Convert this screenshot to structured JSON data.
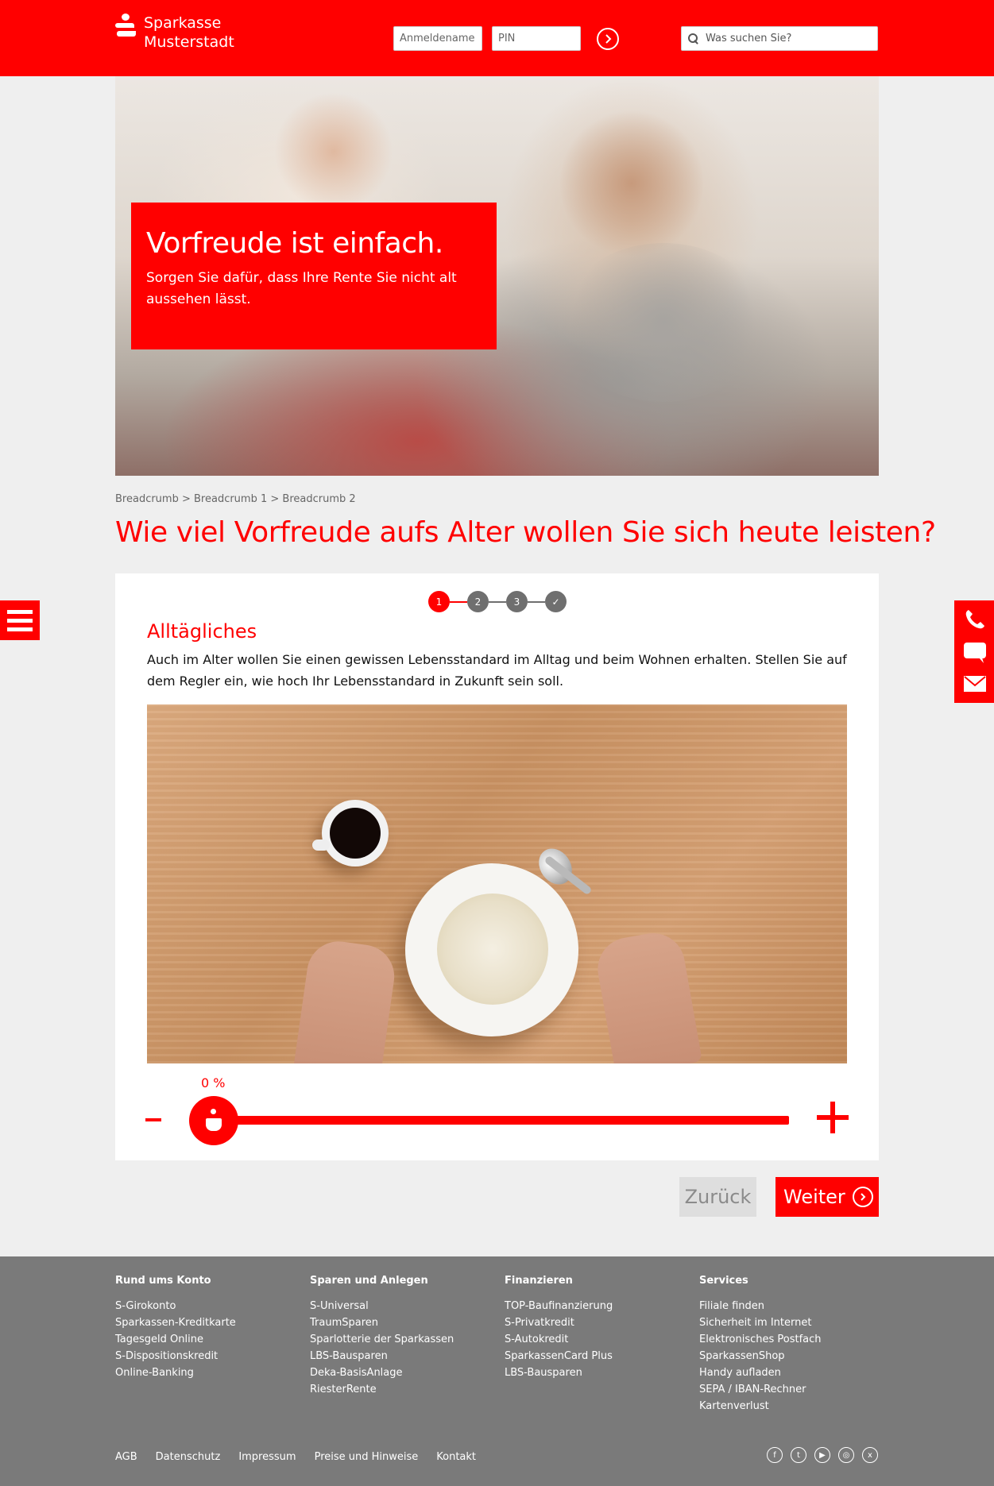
{
  "brand": {
    "line1": "Sparkasse",
    "line2": "Musterstadt"
  },
  "login": {
    "username_placeholder": "Anmeldename",
    "pin_placeholder": "PIN",
    "go_icon": "chevron-right-icon"
  },
  "search": {
    "placeholder": "Was suchen Sie?"
  },
  "hero": {
    "title": "Vorfreude ist einfach.",
    "subtitle": "Sorgen Sie dafür, dass Ihre Rente Sie nicht alt aussehen lässt."
  },
  "breadcrumb": "Breadcrumb > Breadcrumb 1 > Breadcrumb 2",
  "page_title": "Wie viel Vorfreude aufs Alter wollen Sie sich heute leisten?",
  "stepper": {
    "steps": [
      "1",
      "2",
      "3",
      "✓"
    ],
    "active_step": 1
  },
  "section": {
    "title": "Alltägliches",
    "text": "Auch im Alter wollen Sie einen gewissen Lebensstandard im Alltag und beim Wohnen erhalten. Stellen Sie auf dem Regler ein, wie hoch Ihr Lebensstandard in Zukunft sein soll."
  },
  "slider": {
    "value_label": "0 %",
    "value": 0,
    "minus": "-"
  },
  "nav_buttons": {
    "back": "Zurück",
    "next": "Weiter"
  },
  "footer": {
    "columns": [
      {
        "title": "Rund ums Konto",
        "links": [
          "S-Girokonto",
          "Sparkassen-Kreditkarte",
          "Tagesgeld Online",
          "S-Dispositionskredit",
          "Online-Banking"
        ]
      },
      {
        "title": "Sparen und Anlegen",
        "links": [
          "S-Universal",
          "TraumSparen",
          "Sparlotterie der Sparkassen",
          "LBS-Bausparen",
          "Deka-BasisAnlage",
          "RiesterRente"
        ]
      },
      {
        "title": "Finanzieren",
        "links": [
          "TOP-Baufinanzierung",
          "S-Privatkredit",
          "S-Autokredit",
          "SparkassenCard Plus",
          "LBS-Bausparen"
        ]
      },
      {
        "title": "Services",
        "links": [
          "Filiale finden",
          "Sicherheit im Internet",
          "Elektronisches Postfach",
          "SparkassenShop",
          "Handy aufladen",
          "SEPA / IBAN-Rechner",
          "Kartenverlust"
        ]
      }
    ],
    "bottom_links": [
      "AGB",
      "Datenschutz",
      "Impressum",
      "Preise und Hinweise",
      "Kontakt"
    ],
    "social": [
      "facebook-icon",
      "twitter-icon",
      "youtube-icon",
      "instagram-icon",
      "xing-icon"
    ]
  },
  "colors": {
    "brand_red": "#ff0000",
    "footer_gray": "#7a7a7a",
    "page_bg": "#efefef"
  }
}
